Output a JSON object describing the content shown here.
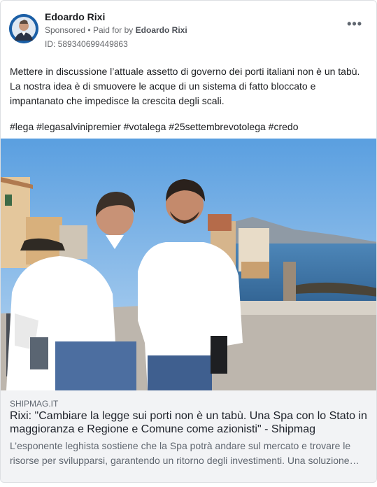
{
  "ad": {
    "advertiser_name": "Edoardo Rixi",
    "sponsored_label": "Sponsored",
    "separator": "•",
    "paid_for_prefix": "Paid for by",
    "paid_for_by": "Edoardo Rixi",
    "library_id": "ID: 589340699449863",
    "more_label": "•••",
    "body_lines": [
      "Mettere in discussione l’attuale assetto di governo dei porti italiani non è un tabù.",
      "La nostra idea è di smuovere le acque di un sistema di fatto bloccato e",
      "impantanato che impedisce la crescita degli scali."
    ],
    "hashtags": "#lega #legasalvinipremier #votalega #25settembrevotolega #credo"
  },
  "link_preview": {
    "domain": "SHIPMAG.IT",
    "headline": "Rixi: \"Cambiare la legge sui porti non è un tabù. Una Spa con lo Stato in maggioranza e Regione e Comune come azionisti\" - Shipmag",
    "description": "L’esponente leghista sostiene che la Spa potrà andare sul mercato e trovare le risorse per svilupparsi, garantendo un ritorno degli investimenti. Una soluzione…"
  },
  "colors": {
    "brand_blue": "#1b5fa6",
    "text_primary": "#1c1e21",
    "text_secondary": "#65676b",
    "link_bg": "#f2f3f5"
  }
}
